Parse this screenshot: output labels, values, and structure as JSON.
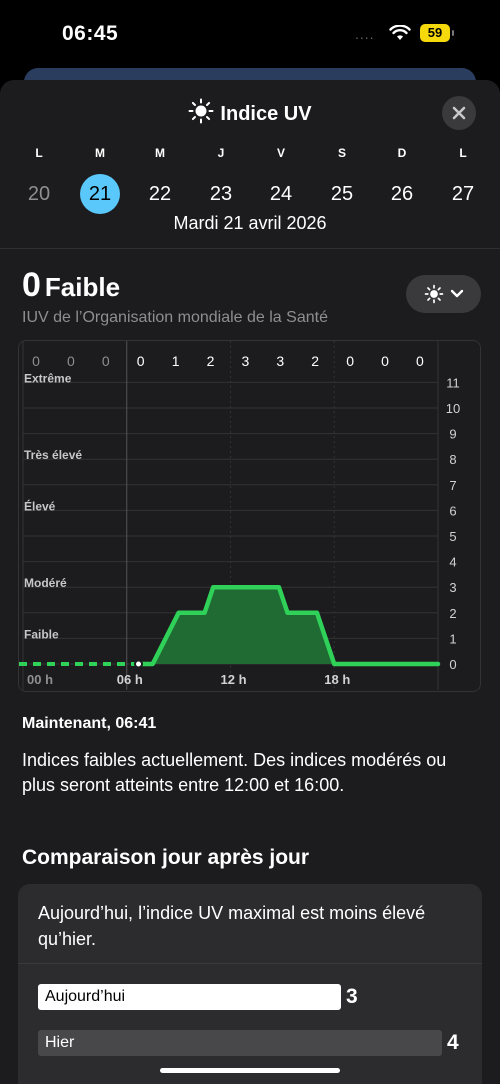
{
  "status_bar": {
    "time": "06:45",
    "signal": "....",
    "battery": "59"
  },
  "header": {
    "title": "Indice UV",
    "icon": "sun-icon",
    "close_icon": "close-icon"
  },
  "week": {
    "days": [
      {
        "letter": "L",
        "num": "20"
      },
      {
        "letter": "M",
        "num": "21"
      },
      {
        "letter": "M",
        "num": "22"
      },
      {
        "letter": "J",
        "num": "23"
      },
      {
        "letter": "V",
        "num": "24"
      },
      {
        "letter": "S",
        "num": "25"
      },
      {
        "letter": "D",
        "num": "26"
      },
      {
        "letter": "L",
        "num": "27"
      }
    ],
    "selected_index": 1,
    "date_label": "Mardi 21 avril 2026"
  },
  "current": {
    "value": "0",
    "category": "Faible",
    "source": "IUV de l’Organisation mondiale de la Santé"
  },
  "chart_data": {
    "type": "area",
    "hourly_labels": [
      "0",
      "0",
      "0",
      "0",
      "1",
      "2",
      "3",
      "3",
      "2",
      "0",
      "0",
      "0"
    ],
    "x_tick_labels": [
      "00 h",
      "06 h",
      "12 h",
      "18 h"
    ],
    "y_tick_labels": [
      "0",
      "1",
      "2",
      "3",
      "4",
      "5",
      "6",
      "7",
      "8",
      "9",
      "10",
      "11"
    ],
    "ylim": [
      0,
      11
    ],
    "xlim": [
      0,
      24
    ],
    "categories": [
      {
        "label": "Faible",
        "y": 1
      },
      {
        "label": "Modéré",
        "y": 3
      },
      {
        "label": "Élevé",
        "y": 6
      },
      {
        "label": "Très élevé",
        "y": 8
      },
      {
        "label": "Extrême",
        "y": 11
      }
    ],
    "series": [
      {
        "x": [
          0,
          6.8,
          7.5,
          9.0,
          9.5,
          10.5,
          11.0,
          12.0,
          14.8,
          15.3,
          16.5,
          17.0,
          18.0,
          24
        ],
        "values": [
          0,
          0,
          0,
          2,
          2,
          2,
          3,
          3,
          3,
          2,
          2,
          2,
          0,
          0
        ]
      }
    ],
    "now_hour": 6.68,
    "colors": {
      "line": "#30d158",
      "fill": "#1f6b33",
      "grid": "#333333"
    }
  },
  "now_section": {
    "title": "Maintenant, 06:41",
    "description": "Indices faibles actuellement. Des indices modérés ou plus seront atteints entre 12:00 et 16:00."
  },
  "comparison": {
    "title": "Comparaison jour après jour",
    "summary": "Aujourd’hui, l’indice UV maximal est moins élevé qu’hier.",
    "today": {
      "label": "Aujourd’hui",
      "value": "3"
    },
    "yesterday": {
      "label": "Hier",
      "value": "4"
    }
  }
}
